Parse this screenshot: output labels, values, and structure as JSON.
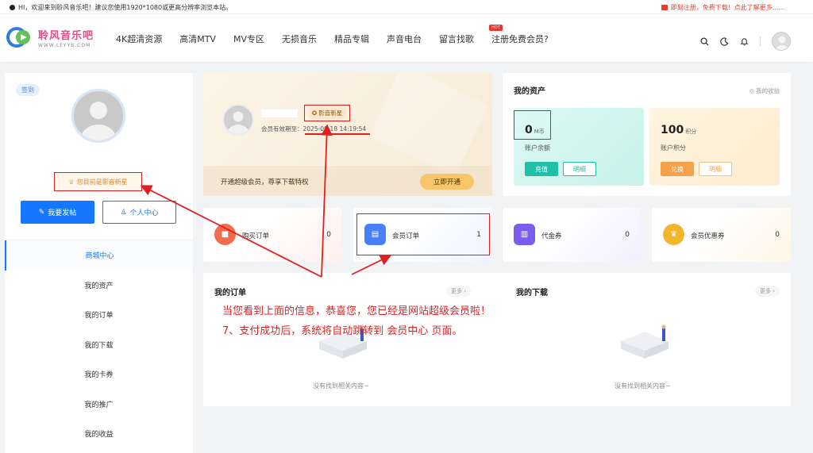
{
  "notice": {
    "left_text": "HI，欢迎来到聆风音乐吧！建议您使用1920*1080或更高分辨率浏览本站。",
    "right_text": "即刻注册，免费下载！点此了解更多......"
  },
  "logo": {
    "cn": "聆风音乐吧",
    "en": "WWW.LFYYB.COM"
  },
  "nav": {
    "items": [
      "4K超清资源",
      "高清MTV",
      "MV专区",
      "无损音乐",
      "精品专辑",
      "声音电台",
      "留言找歌",
      "注册免费会员?"
    ],
    "hot_badge": "HOT"
  },
  "sidebar": {
    "signin": "签到",
    "badge": "您目前是影音新星",
    "post_button": "我要发帖",
    "user_button": "个人中心",
    "menu": [
      "商城中心",
      "我的资产",
      "我的订单",
      "我的下载",
      "我的卡券",
      "我的推广",
      "我的收益"
    ]
  },
  "member": {
    "badge": "影音新星",
    "expire_label": "会员有效期至：",
    "expire_date": "2025-09-18 14:19:54",
    "vip_text": "开通超级会员，尊享下载特权",
    "open_button": "立即开通"
  },
  "assets": {
    "title": "我的资产",
    "income_link": "我的收益",
    "coin": {
      "value": "0",
      "unit": "M币",
      "label": "账户余额",
      "btn1": "充值",
      "btn2": "明细"
    },
    "points": {
      "value": "100",
      "unit": "积分",
      "label": "账户积分",
      "btn1": "兑换",
      "btn2": "明细"
    }
  },
  "stats": [
    {
      "label": "购买订单",
      "count": "0",
      "color": "#f26b4c"
    },
    {
      "label": "会员订单",
      "count": "1",
      "color": "#4a7ef5"
    },
    {
      "label": "代金券",
      "count": "0",
      "color": "#7a5cf0"
    },
    {
      "label": "会员优惠券",
      "count": "0",
      "color": "#f5b52a"
    }
  ],
  "orders": {
    "title": "我的订单",
    "more": "更多 ›",
    "empty": "没有找到相关内容~"
  },
  "downloads": {
    "title": "我的下载",
    "more": "更多 ›",
    "empty": "没有找到相关内容~"
  },
  "annotations": {
    "line1": "当您看到上面的信息，恭喜您，您已经是网站超级会员啦！",
    "line2": "7、支付成功后，系统将自动跳转到 会员中心 页面。"
  },
  "colors": {
    "primary": "#1677ff",
    "annotation": "#e02020",
    "teal": "#1fbfa8",
    "orange": "#f5a04a"
  }
}
